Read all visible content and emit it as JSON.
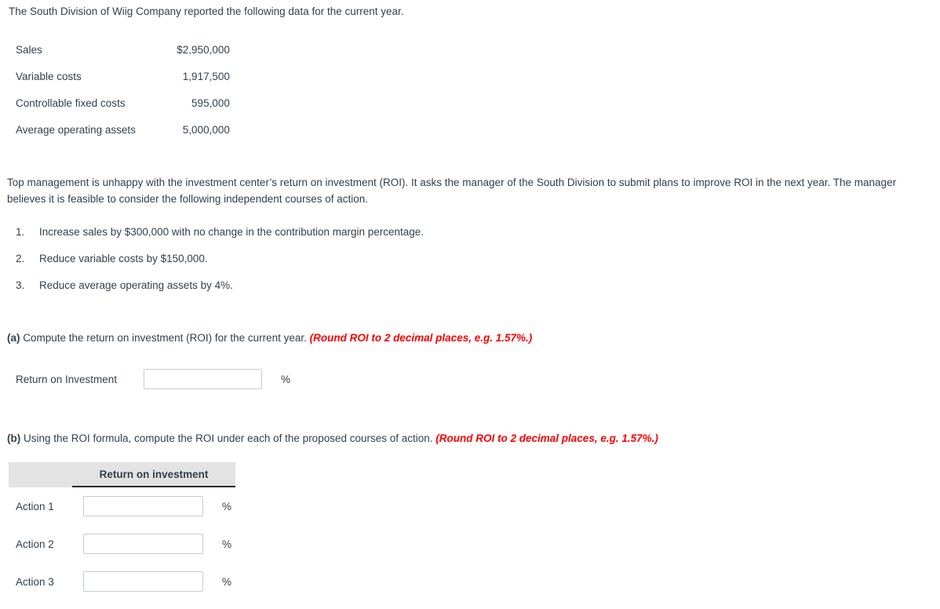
{
  "intro": {
    "text": "The South Division of Wiig Company reported the following data for the current year."
  },
  "data_table": {
    "rows": [
      {
        "label": "Sales",
        "value": "$2,950,000"
      },
      {
        "label": "Variable costs",
        "value": "1,917,500"
      },
      {
        "label": "Controllable fixed costs",
        "value": "595,000"
      },
      {
        "label": "Average operating assets",
        "value": "5,000,000"
      }
    ]
  },
  "paragraph": {
    "text": "Top management is unhappy with the investment center’s return on investment (ROI). It asks the manager of the South Division to submit plans to improve ROI in the next year. The manager believes it is feasible to consider the following independent courses of action."
  },
  "actions": [
    {
      "num": "1.",
      "text": "Increase sales by $300,000 with no change in the contribution margin percentage."
    },
    {
      "num": "2.",
      "text": "Reduce variable costs by $150,000."
    },
    {
      "num": "3.",
      "text": "Reduce average operating assets by 4%."
    }
  ],
  "part_a": {
    "marker": "(a)",
    "prompt": " Compute the return on investment (ROI) for the current year. ",
    "round_note": "(Round ROI to 2 decimal places, e.g. 1.57%.)",
    "answer_label": "Return on Investment",
    "input_value": "",
    "input_placeholder": "",
    "percent_symbol": "%"
  },
  "part_b": {
    "marker": "(b)",
    "prompt": " Using the ROI formula, compute the ROI under each of the proposed courses of action. ",
    "round_note": "(Round ROI to 2 decimal places, e.g. 1.57%.)",
    "column_header": "Return on investment",
    "rows": [
      {
        "label": "Action 1",
        "value": "",
        "placeholder": "",
        "percent_symbol": "%"
      },
      {
        "label": "Action 2",
        "value": "",
        "placeholder": "",
        "percent_symbol": "%"
      },
      {
        "label": "Action 3",
        "value": "",
        "placeholder": "",
        "percent_symbol": "%"
      }
    ]
  },
  "colors": {
    "text": "#33404d",
    "note_red": "#fc0000",
    "header_bg": "#e3e3e3",
    "header_underline": "#2b2b2b",
    "input_border": "#c8ccd0",
    "page_bg": "#ffffff"
  }
}
